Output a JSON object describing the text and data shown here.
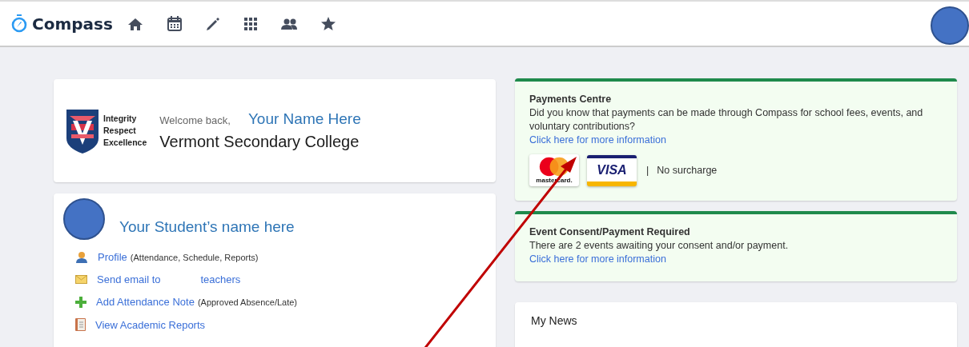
{
  "header": {
    "brand": "Compass"
  },
  "welcome_card": {
    "motto": [
      "Integrity",
      "Respect",
      "Excellence"
    ],
    "greeting": "Welcome back,",
    "name": "Your Name Here",
    "school": "Vermont Secondary College"
  },
  "student_card": {
    "name": "Your Student’s name here",
    "links": [
      {
        "kind": "profile",
        "label": "Profile",
        "note": "(Attendance, Schedule, Reports)"
      },
      {
        "kind": "email",
        "label": "Send email to",
        "trailing": "teachers"
      },
      {
        "kind": "add",
        "label": "Add Attendance Note",
        "note": "(Approved Absence/Late)"
      },
      {
        "kind": "reports",
        "label": "View Academic Reports"
      }
    ]
  },
  "alerts": [
    {
      "title": "Payments Centre",
      "text": "Did you know that payments can be made through Compass for school fees, events, and voluntary contributions?",
      "link": "Click here for more information",
      "payment_row": {
        "mastercard": "mastercard.",
        "visa": "VISA",
        "separator": "|",
        "note": "No surcharge"
      }
    },
    {
      "title": "Event Consent/Payment Required",
      "text": "There are 2 events awaiting your consent and/or payment.",
      "link": "Click here for more information"
    }
  ],
  "news": {
    "title": "My News"
  }
}
